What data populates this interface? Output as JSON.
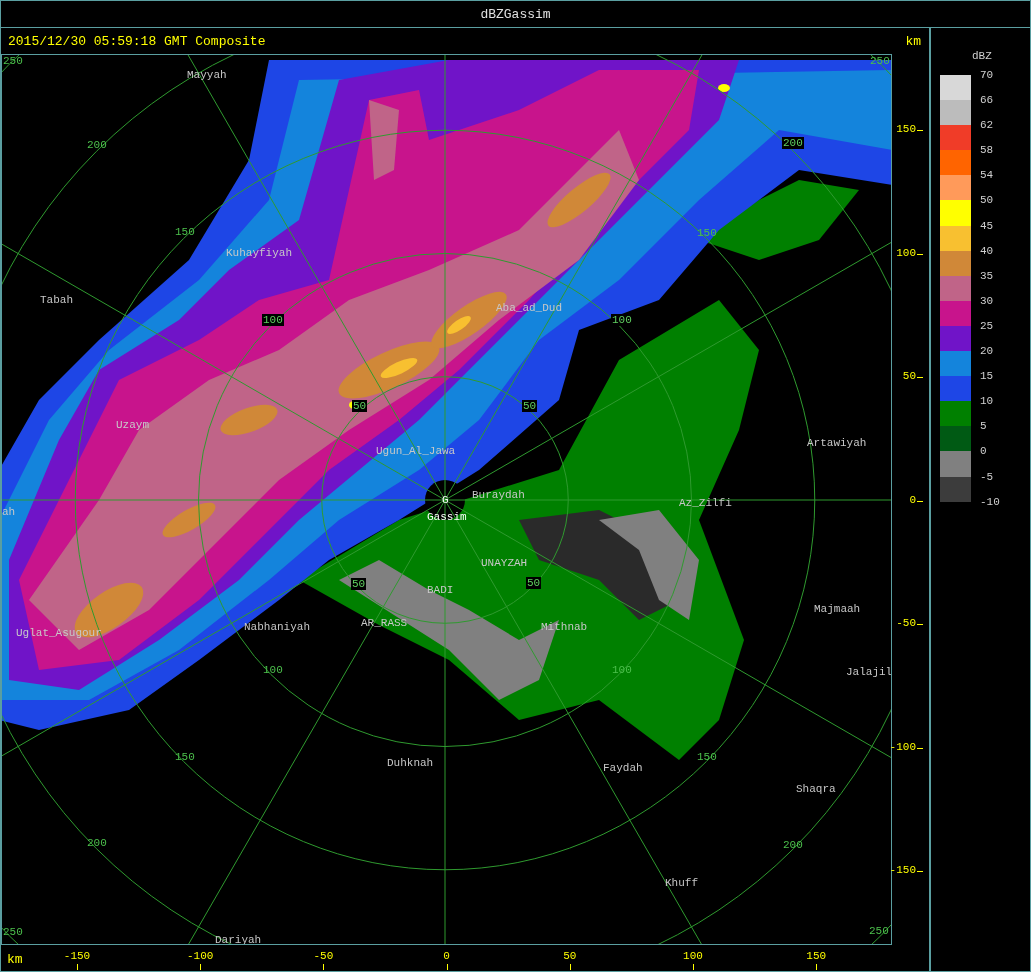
{
  "window": {
    "title": "dBZGassim"
  },
  "header": {
    "timestamp": "2015/12/30 05:59:18 GMT Composite",
    "unit": "km"
  },
  "map": {
    "site_marker": "G",
    "ring_labels": [
      {
        "text": "250",
        "boxed": false
      },
      {
        "text": "200",
        "boxed": false
      },
      {
        "text": "150",
        "boxed": false
      },
      {
        "text": "100",
        "boxed": true
      },
      {
        "text": "50",
        "boxed": true
      },
      {
        "text": "50",
        "boxed": true
      },
      {
        "text": "100",
        "boxed": true
      },
      {
        "text": "150",
        "boxed": false
      },
      {
        "text": "200",
        "boxed": true
      },
      {
        "text": "250",
        "boxed": false
      },
      {
        "text": "50",
        "boxed": true
      },
      {
        "text": "50",
        "boxed": true
      },
      {
        "text": "100",
        "boxed": false
      },
      {
        "text": "150",
        "boxed": false
      },
      {
        "text": "200",
        "boxed": false
      },
      {
        "text": "250",
        "boxed": false
      },
      {
        "text": "100",
        "boxed": false
      },
      {
        "text": "150",
        "boxed": false
      },
      {
        "text": "200",
        "boxed": false
      },
      {
        "text": "250",
        "boxed": false
      }
    ],
    "places": [
      {
        "name": "Mayyah",
        "kind": "town"
      },
      {
        "name": "Kuhayfiyah",
        "kind": "town"
      },
      {
        "name": "Tabah",
        "kind": "town"
      },
      {
        "name": "Aba_ad_Dud",
        "kind": "town"
      },
      {
        "name": "Uzaym",
        "kind": "town"
      },
      {
        "name": "Ugun_Al_Jawa",
        "kind": "town"
      },
      {
        "name": "ah",
        "kind": "town"
      },
      {
        "name": "Gassim",
        "kind": "site"
      },
      {
        "name": "Buraydah",
        "kind": "town"
      },
      {
        "name": "Az_Zilfi",
        "kind": "town"
      },
      {
        "name": "Artawiyah",
        "kind": "town"
      },
      {
        "name": "UNAYZAH",
        "kind": "town"
      },
      {
        "name": "BADI",
        "kind": "town"
      },
      {
        "name": "Uglat_Asugour",
        "kind": "town"
      },
      {
        "name": "Nabhaniyah",
        "kind": "town"
      },
      {
        "name": "AR_RASS",
        "kind": "town"
      },
      {
        "name": "Mithnab",
        "kind": "town"
      },
      {
        "name": "Majmaah",
        "kind": "town"
      },
      {
        "name": "Jalajil",
        "kind": "town"
      },
      {
        "name": "Duhknah",
        "kind": "town"
      },
      {
        "name": "Faydah",
        "kind": "town"
      },
      {
        "name": "Shaqra",
        "kind": "town"
      },
      {
        "name": "Khuff",
        "kind": "town"
      },
      {
        "name": "Dariyah",
        "kind": "town"
      }
    ]
  },
  "y_axis": {
    "ticks": [
      "150",
      "100",
      "50",
      "0",
      "-50",
      "-100",
      "-150"
    ]
  },
  "x_axis": {
    "unit": "km",
    "ticks": [
      "-150",
      "-100",
      "-50",
      "0",
      "50",
      "100",
      "150"
    ]
  },
  "legend": {
    "title": "dBZ",
    "labels": [
      "70",
      "66",
      "62",
      "58",
      "54",
      "50",
      "45",
      "40",
      "35",
      "30",
      "25",
      "20",
      "15",
      "10",
      "5",
      "0",
      "-5",
      "-10"
    ],
    "swatches": [
      {
        "color": "#d8d8d8"
      },
      {
        "color": "#bcbcbc"
      },
      {
        "color": "#f03c28"
      },
      {
        "color": "#ff6400"
      },
      {
        "color": "#ff9a5a"
      },
      {
        "color": "#ffff00"
      },
      {
        "color": "#f8c030"
      },
      {
        "color": "#d08838"
      },
      {
        "color": "#c06488"
      },
      {
        "color": "#c8148c"
      },
      {
        "color": "#7014c8"
      },
      {
        "color": "#1484dc"
      },
      {
        "color": "#1e46e6"
      },
      {
        "color": "#008000"
      },
      {
        "color": "#005a14"
      },
      {
        "color": "#808080"
      },
      {
        "color": "#3c3c3c"
      }
    ]
  }
}
